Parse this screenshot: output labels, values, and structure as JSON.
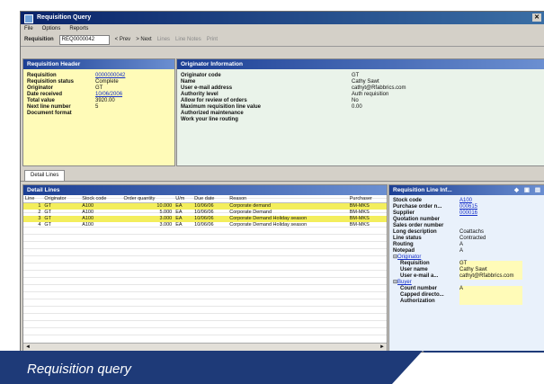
{
  "window": {
    "title": "Requisition Query"
  },
  "menu": [
    "File",
    "Options",
    "Reports"
  ],
  "toolbar": {
    "dropdown_label": "Requisition",
    "dropdown_value": "REQ0000042",
    "prev": "< Prev",
    "next": "> Next",
    "items": [
      "Lines",
      "Line Notes",
      "Print"
    ]
  },
  "requisition_header": {
    "title": "Requisition Header",
    "fields": [
      {
        "label": "Requisition",
        "value": "0000000042",
        "link": true
      },
      {
        "label": "Requisition status",
        "value": "Complete",
        "link": false
      },
      {
        "label": "Originator",
        "value": "GT",
        "link": false
      },
      {
        "label": "Date received",
        "value": "10/06/2006",
        "link": true
      },
      {
        "label": "Total value",
        "value": "3920.00",
        "link": false
      },
      {
        "label": "Next line number",
        "value": "5",
        "link": false
      },
      {
        "label": "Document format",
        "value": "",
        "link": false
      }
    ]
  },
  "originator_info": {
    "title": "Originator Information",
    "fields": [
      {
        "label": "Originator code",
        "value": "GT"
      },
      {
        "label": "Name",
        "value": "Cathy Sawt"
      },
      {
        "label": "User e-mail address",
        "value": "cathyt@Rfabbrics.com"
      },
      {
        "label": "Authority level",
        "value": "Auth requisition"
      },
      {
        "label": "Allow for review of orders",
        "value": "No"
      },
      {
        "label": "Maximum requisition line value",
        "value": "0.00"
      },
      {
        "label": "Authorized maintenance",
        "value": ""
      },
      {
        "label": "Work your line routing",
        "value": ""
      }
    ]
  },
  "tabs": [
    "Detail Lines"
  ],
  "detail_lines": {
    "title": "Detail Lines",
    "columns": [
      "Line",
      "Originator",
      "Stock code",
      "Order quantity",
      "U/m",
      "Due date",
      "Reason",
      "Purchaser"
    ],
    "rows": [
      {
        "line": "1",
        "orig": "GT",
        "stock": "A100",
        "qty": "10.000",
        "uom": "EA",
        "due": "10/06/06",
        "reason": "Corporate demand",
        "purch": "BM-MKS"
      },
      {
        "line": "2",
        "orig": "GT",
        "stock": "A100",
        "qty": "5.000",
        "uom": "EA",
        "due": "10/06/06",
        "reason": "Corporate Demand",
        "purch": "BM-MKS"
      },
      {
        "line": "3",
        "orig": "GT",
        "stock": "A100",
        "qty": "3.000",
        "uom": "EA",
        "due": "10/06/06",
        "reason": "Corporate Demand Holiday season",
        "purch": "BM-MKS"
      },
      {
        "line": "4",
        "orig": "GT",
        "stock": "A100",
        "qty": "3.000",
        "uom": "EA",
        "due": "10/06/06",
        "reason": "Corporate Demand Holiday season",
        "purch": "BM-MKS"
      }
    ],
    "highlighted_rows": [
      0,
      2
    ]
  },
  "line_info": {
    "title": "Requisition Line Inf...",
    "fields": [
      {
        "label": "Stock code",
        "value": "A100",
        "link": true
      },
      {
        "label": "Purchase order n...",
        "value": "000615",
        "link": true
      },
      {
        "label": "Supplier",
        "value": "000016",
        "link": true
      },
      {
        "label": "Quotation number",
        "value": "",
        "link": false
      },
      {
        "label": "Sales order number",
        "value": "",
        "link": false
      },
      {
        "label": "Long description",
        "value": "Coattachs",
        "link": false
      },
      {
        "label": "Line status",
        "value": "Contracted",
        "link": false
      },
      {
        "label": "Routing",
        "value": "A",
        "link": false
      },
      {
        "label": "Notepad",
        "value": "A",
        "link": false
      }
    ],
    "group_originator": {
      "title": "Originator",
      "fields": [
        {
          "label": "Requisition",
          "value": "GT"
        },
        {
          "label": "User name",
          "value": "Cathy Sawt"
        },
        {
          "label": "User e-mail a...",
          "value": "cathyt@Rfabbrics.com"
        }
      ]
    },
    "group_buyer": {
      "title": "Buyer",
      "fields": [
        {
          "label": "Count number",
          "value": "A"
        },
        {
          "label": "Capped directo...",
          "value": ""
        },
        {
          "label": "Authorization",
          "value": ""
        }
      ]
    }
  },
  "caption": "Requisition query",
  "colors": {
    "panel_header": "#1c3f94",
    "caption_bg": "#1e3a78",
    "highlight": "#f3ee5c",
    "yellow_panel": "#fffbb8"
  }
}
